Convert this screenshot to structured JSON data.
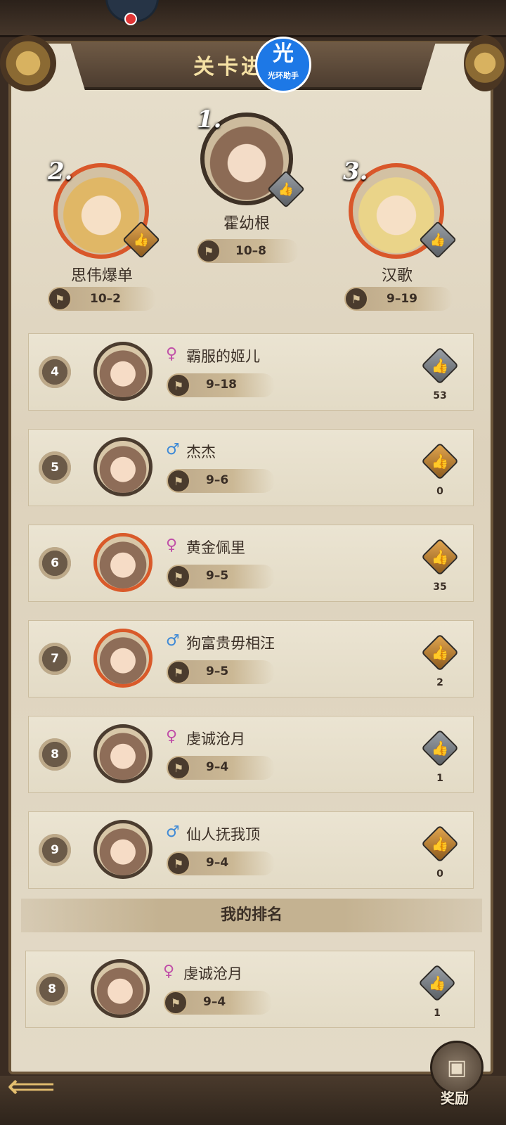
{
  "header": {
    "title": "关卡进度榜",
    "watermark_big": "光",
    "watermark_small": "光环助手"
  },
  "podium": [
    {
      "rank": "1.",
      "name": "霍幼根",
      "stage": "10–8"
    },
    {
      "rank": "2.",
      "name": "思伟爆单",
      "stage": "10–2"
    },
    {
      "rank": "3.",
      "name": "汉歌",
      "stage": "9–19"
    }
  ],
  "rows": [
    {
      "rank": "4",
      "gender": "♀",
      "name": "霸服的姬儿",
      "stage": "9–18",
      "likes": "53"
    },
    {
      "rank": "5",
      "gender": "♂",
      "name": "杰杰",
      "stage": "9–6",
      "likes": "0"
    },
    {
      "rank": "6",
      "gender": "♀",
      "name": "黄金佩里",
      "stage": "9–5",
      "likes": "35"
    },
    {
      "rank": "7",
      "gender": "♂",
      "name": "狗富贵毋相汪",
      "stage": "9–5",
      "likes": "2"
    },
    {
      "rank": "8",
      "gender": "♀",
      "name": "虔诚沧月",
      "stage": "9–4",
      "likes": "1"
    },
    {
      "rank": "9",
      "gender": "♂",
      "name": "仙人抚我顶",
      "stage": "9–4",
      "likes": "0"
    }
  ],
  "my_rank": {
    "header": "我的排名",
    "rank": "8",
    "gender": "♀",
    "name": "虔诚沧月",
    "stage": "9–4",
    "likes": "1"
  },
  "footer": {
    "back_icon": "back-arrow-icon",
    "reward_label": "奖励"
  },
  "icons": {
    "like": "👍",
    "flag": "⚑",
    "back": "⟸",
    "reward": "▣"
  }
}
